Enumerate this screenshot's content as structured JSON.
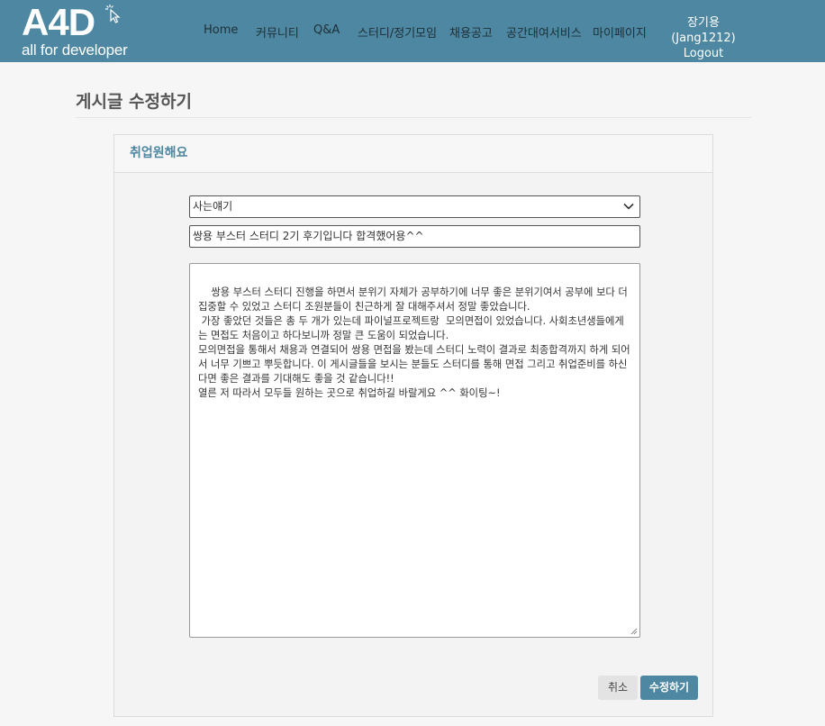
{
  "header": {
    "logo_main": "A4D",
    "logo_sub": "all for developer",
    "nav": [
      "Home",
      "커뮤니티",
      "Q&A",
      "스터디/정기모임",
      "채용공고",
      "공간대여서비스",
      "마이페이지"
    ],
    "user_name": "장기용(Jang1212)",
    "logout": "Logout",
    "colors": {
      "bar": "#4d87a1"
    }
  },
  "page": {
    "title": "게시글 수정하기"
  },
  "form": {
    "heading": "취업원해요",
    "category": "사는얘기",
    "post_title": "쌍용 부스터 스터디 2기 후기입니다 합격했어용^^",
    "body": "쌍용 부스터 스터디 진행을 하면서 분위기 자체가 공부하기에 너무 좋은 분위기여서 공부에 보다 더 집중할 수 있었고 스터디 조원분들이 친근하게 잘 대해주셔서 정말 좋았습니다.\n 가장 좋았던 것들은 총 두 개가 있는데 파이널프로젝트랑  모의면접이 있었습니다. 사회초년생들에게는 면접도 처음이고 하다보니까 정말 큰 도움이 되었습니다.\n모의면접을 통해서 채용과 연결되어 쌍용 면접을 봤는데 스터디 노력이 결과로 최종합격까지 하게 되어서 너무 기쁘고 뿌듯합니다. 이 게시글들을 보시는 분들도 스터디를 통해 면접 그리고 취업준비를 하신다면 좋은 결과를 기대해도 좋을 것 같습니다!!\n열른 저 따라서 모두들 원하는 곳으로 취업하길 바랄게요 ^^ 화이팅~!",
    "cancel_label": "취소",
    "submit_label": "수정하기"
  }
}
